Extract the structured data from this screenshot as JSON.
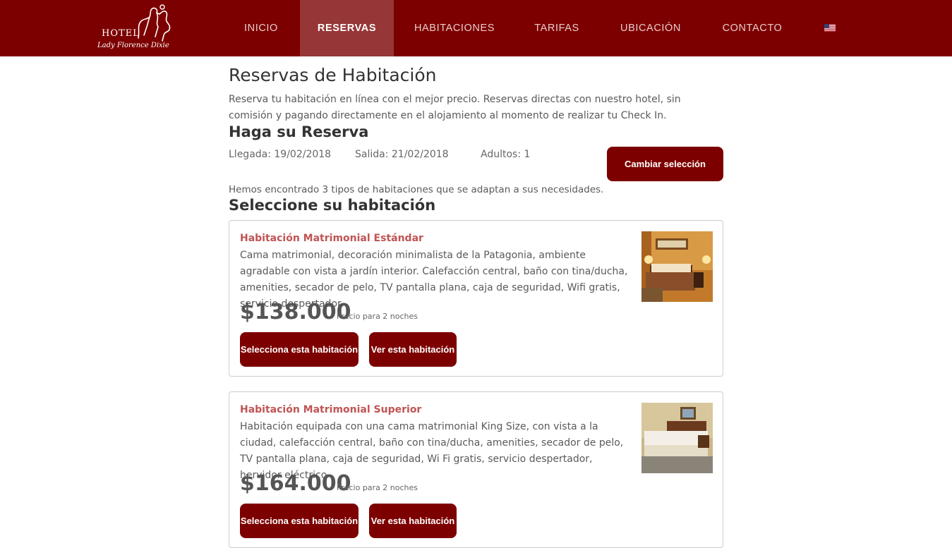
{
  "brand": {
    "logo_word": "HOTEL",
    "logo_script": "Lady Florence Dixie"
  },
  "nav": {
    "items": [
      {
        "label": "INICIO",
        "active": false
      },
      {
        "label": "RESERVAS",
        "active": true
      },
      {
        "label": "HABITACIONES",
        "active": false
      },
      {
        "label": "TARIFAS",
        "active": false
      },
      {
        "label": "UBICACIÓN",
        "active": false
      },
      {
        "label": "CONTACTO",
        "active": false
      }
    ],
    "language_icon": "us-flag-icon"
  },
  "page": {
    "title": "Reservas de Habitación",
    "intro": "Reserva tu habitación en línea con el mejor precio. Reservas directas con nuestro hotel, sin comisión y pagando directamente en el alojamiento al momento de realizar tu Check In.",
    "subtitle": "Haga su Reserva"
  },
  "selection": {
    "arrival": "Llegada: 19/02/2018",
    "departure": "Salida: 21/02/2018",
    "adults": "Adultos: 1",
    "change_button": "Cambiar selección"
  },
  "results": {
    "found_text": "Hemos encontrado 3 tipos de habitaciones que se adaptan a sus necesidades.",
    "select_title": "Seleccione su habitación"
  },
  "rooms": [
    {
      "name": "Habitación Matrimonial Estándar",
      "description": "Cama matrimonial, decoración minimalista de la Patagonia, ambiente agradable con vista a jardín interior. Calefacción central, baño con tina/ducha, amenities, secador de pelo, TV pantalla plana, caja de seguridad, Wifi gratis, servicio despertador.",
      "price": "$138.000",
      "price_note": "Precio para 2 noches",
      "select_button": "Selecciona esta habitación",
      "view_button": "Ver esta habitación"
    },
    {
      "name": "Habitación Matrimonial Superior",
      "description": "Habitación equipada con una cama matrimonial King Size, con vista a la ciudad, calefacción central, baño con tina/ducha, amenities, secador de pelo, TV pantalla plana, caja de seguridad, Wi Fi gratis, servicio despertador, hervidor eléctrico",
      "price": "$164.000",
      "price_note": "Precio para 2 noches",
      "select_button": "Selecciona esta habitación",
      "view_button": "Ver esta habitación"
    }
  ],
  "colors": {
    "brand": "#7d0000",
    "nav_active": "#963636",
    "room_name": "#c05454"
  }
}
